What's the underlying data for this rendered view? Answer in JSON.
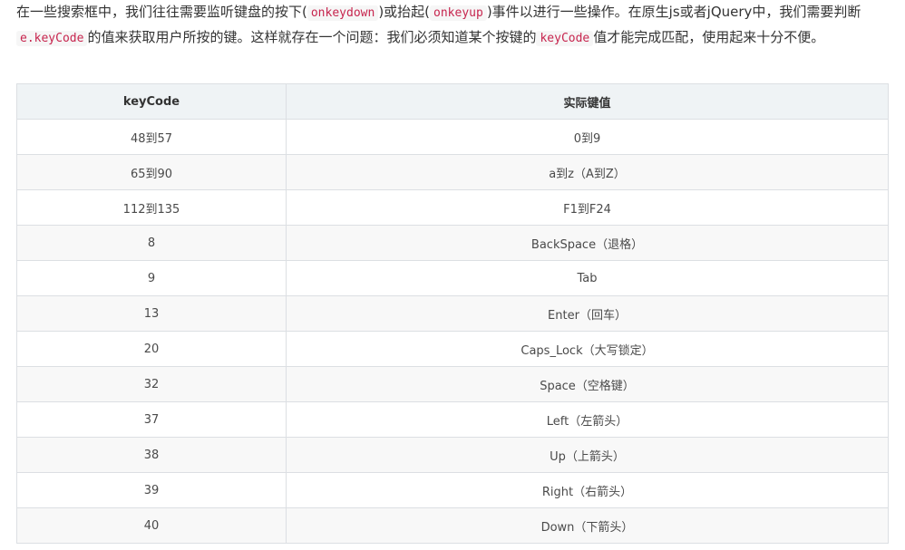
{
  "intro": {
    "t1": "在一些搜索框中，我们往往需要监听键盘的按下(",
    "c1": "onkeydown",
    "t2": ")或抬起(",
    "c2": "onkeyup",
    "t3": ")事件以进行一些操作。在原生js或者jQuery中，我们需要判断",
    "c3": "e.keyCode",
    "t4": "的值来获取用户所按的键。这样就存在一个问题：我们必须知道某个按键的",
    "c4": "keyCode",
    "t5": "值才能完成匹配，使用起来十分不便。"
  },
  "table": {
    "headers": [
      "keyCode",
      "实际键值"
    ],
    "rows": [
      [
        "48到57",
        "0到9"
      ],
      [
        "65到90",
        "a到z（A到Z）"
      ],
      [
        "112到135",
        "F1到F24"
      ],
      [
        "8",
        "BackSpace（退格）"
      ],
      [
        "9",
        "Tab"
      ],
      [
        "13",
        "Enter（回车）"
      ],
      [
        "20",
        "Caps_Lock（大写锁定）"
      ],
      [
        "32",
        "Space（空格键）"
      ],
      [
        "37",
        "Left（左箭头）"
      ],
      [
        "38",
        "Up（上箭头）"
      ],
      [
        "39",
        "Right（右箭头）"
      ],
      [
        "40",
        "Down（下箭头）"
      ]
    ]
  }
}
